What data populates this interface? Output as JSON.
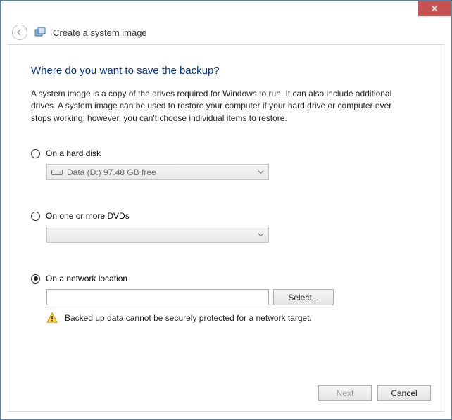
{
  "window": {
    "title": "Create a system image"
  },
  "page": {
    "heading": "Where do you want to save the backup?",
    "description": "A system image is a copy of the drives required for Windows to run. It can also include additional drives. A system image can be used to restore your computer if your hard drive or computer ever stops working; however, you can't choose individual items to restore."
  },
  "options": {
    "hard_disk": {
      "label": "On a hard disk",
      "selected_value": "Data (D:)  97.48 GB free",
      "checked": false
    },
    "dvd": {
      "label": "On one or more DVDs",
      "selected_value": "",
      "checked": false
    },
    "network": {
      "label": "On a network location",
      "path_value": "",
      "select_button": "Select...",
      "warning": "Backed up data cannot be securely protected for a network target.",
      "checked": true
    }
  },
  "footer": {
    "next": "Next",
    "cancel": "Cancel"
  }
}
